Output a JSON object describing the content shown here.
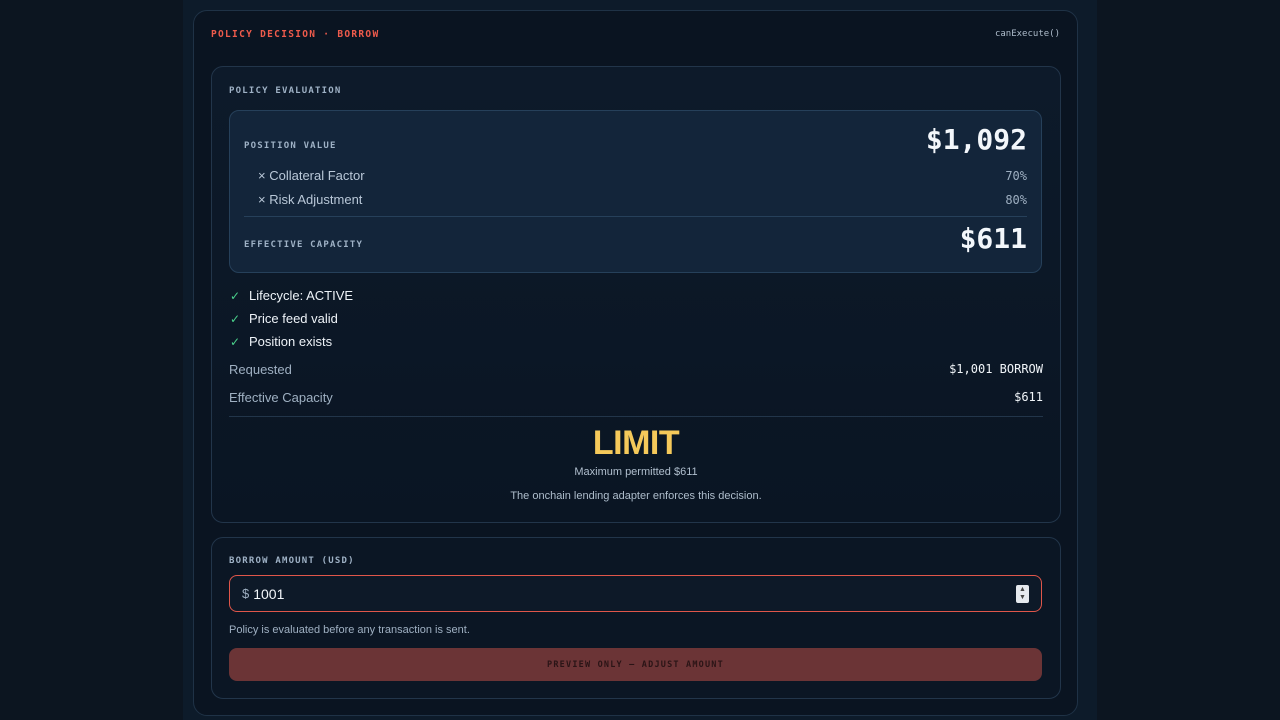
{
  "header": {
    "title": "POLICY DECISION · BORROW",
    "function": "canExecute()"
  },
  "evaluation": {
    "label": "POLICY EVALUATION",
    "position_value_label": "POSITION VALUE",
    "position_value": "$1,092",
    "collateral_factor_label": "× Collateral Factor",
    "collateral_factor": "70%",
    "risk_adjustment_label": "× Risk Adjustment",
    "risk_adjustment": "80%",
    "effective_capacity_label": "EFFECTIVE CAPACITY",
    "effective_capacity": "$611"
  },
  "checks": [
    "Lifecycle: ACTIVE",
    "Price feed valid",
    "Position exists"
  ],
  "summary": {
    "requested_label": "Requested",
    "requested_value": "$1,001 BORROW",
    "capacity_label": "Effective Capacity",
    "capacity_value": "$611"
  },
  "verdict": {
    "label": "LIMIT",
    "max_text": "Maximum permitted $611",
    "note": "The onchain lending adapter enforces this decision."
  },
  "borrow": {
    "label": "BORROW AMOUNT (USD)",
    "currency": "$",
    "value": "1001",
    "hint": "Policy is evaluated before any transaction is sent.",
    "button_label": "PREVIEW ONLY — ADJUST AMOUNT"
  },
  "colors": {
    "accent_red": "#ef5b4c",
    "limit_yellow": "#f5c95a",
    "check_green": "#4ad08b"
  }
}
